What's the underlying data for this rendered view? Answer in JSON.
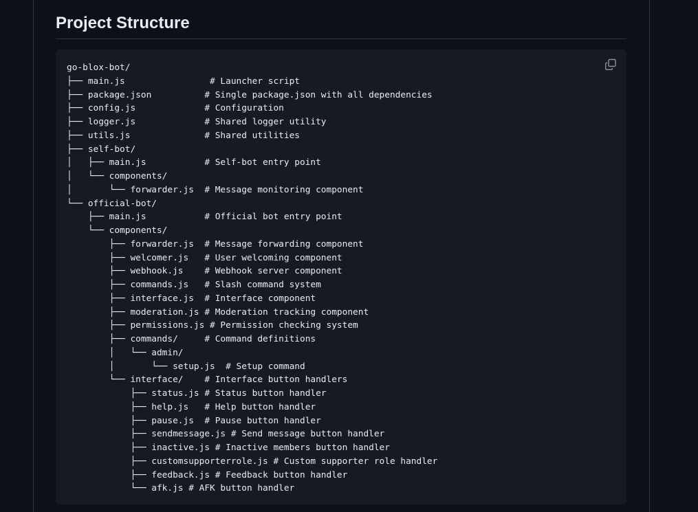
{
  "heading": "Project Structure",
  "copy_icon": "copy-icon",
  "code_lines": [
    "go-blox-bot/",
    "├── main.js                # Launcher script",
    "├── package.json          # Single package.json with all dependencies",
    "├── config.js             # Configuration",
    "├── logger.js             # Shared logger utility",
    "├── utils.js              # Shared utilities",
    "├── self-bot/",
    "│   ├── main.js           # Self-bot entry point",
    "│   └── components/",
    "│       └── forwarder.js  # Message monitoring component",
    "└── official-bot/",
    "    ├── main.js           # Official bot entry point",
    "    └── components/",
    "        ├── forwarder.js  # Message forwarding component",
    "        ├── welcomer.js   # User welcoming component",
    "        ├── webhook.js    # Webhook server component",
    "        ├── commands.js   # Slash command system",
    "        ├── interface.js  # Interface component",
    "        ├── moderation.js # Moderation tracking component",
    "        ├── permissions.js # Permission checking system",
    "        ├── commands/     # Command definitions",
    "        │   └── admin/",
    "        │       └── setup.js  # Setup command",
    "        └── interface/    # Interface button handlers",
    "            ├── status.js # Status button handler",
    "            ├── help.js   # Help button handler",
    "            ├── pause.js  # Pause button handler",
    "            ├── sendmessage.js # Send message button handler",
    "            ├── inactive.js # Inactive members button handler",
    "            ├── customsupporterrole.js # Custom supporter role handler",
    "            ├── feedback.js # Feedback button handler",
    "            └── afk.js # AFK button handler"
  ]
}
